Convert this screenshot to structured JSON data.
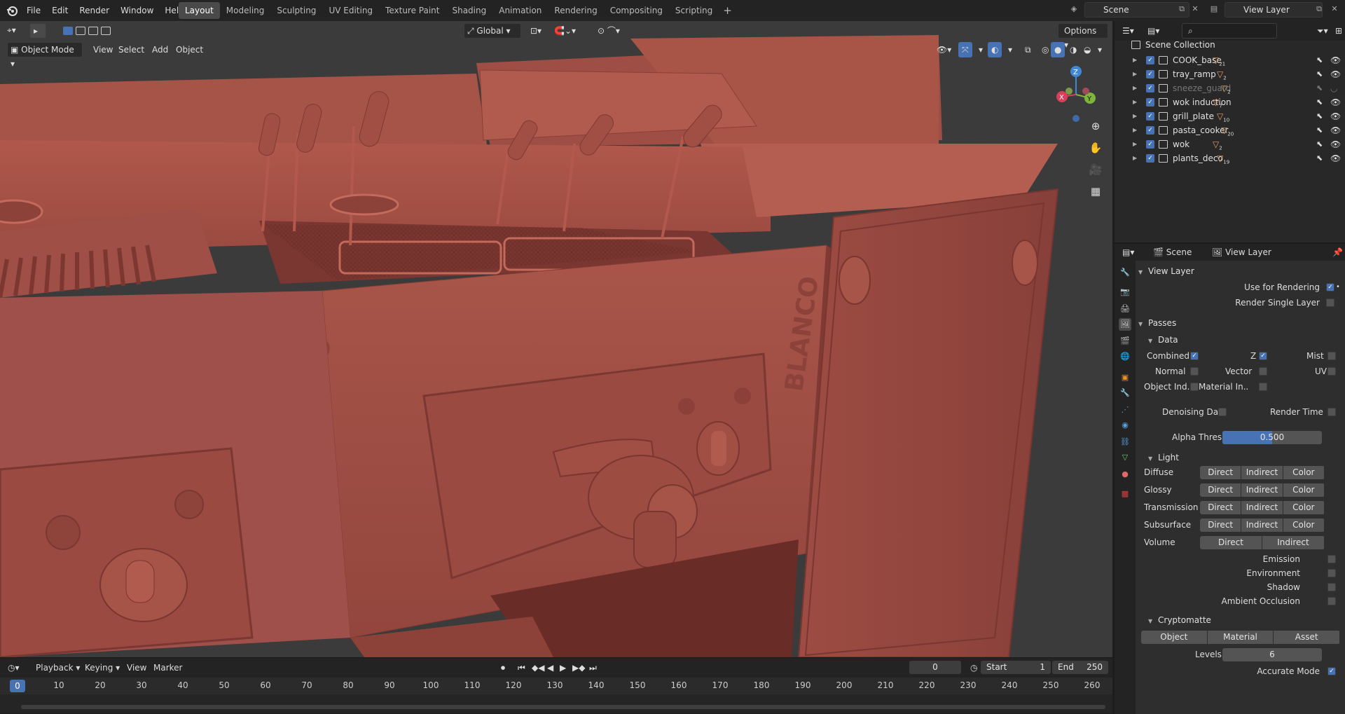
{
  "menu": {
    "items": [
      "File",
      "Edit",
      "Render",
      "Window",
      "Help"
    ]
  },
  "workspaces": {
    "tabs": [
      "Layout",
      "Modeling",
      "Sculpting",
      "UV Editing",
      "Texture Paint",
      "Shading",
      "Animation",
      "Rendering",
      "Compositing",
      "Scripting"
    ],
    "active": "Layout",
    "add": "+"
  },
  "scene": {
    "name": "Scene",
    "view_layer": "View Layer"
  },
  "viewport": {
    "mode": "Object Mode",
    "menus": [
      "View",
      "Select",
      "Add",
      "Object"
    ],
    "orientation": "Global",
    "options": "Options",
    "gizmo": {
      "z": "Z",
      "y": "Y",
      "x": "X"
    },
    "model_text": "BLANCO"
  },
  "timeline": {
    "menus": [
      "Playback",
      "Keying",
      "View",
      "Marker"
    ],
    "current_frame": "0",
    "start_label": "Start",
    "start": "1",
    "end_label": "End",
    "end": "250",
    "ruler": [
      "0",
      "10",
      "20",
      "30",
      "40",
      "50",
      "60",
      "70",
      "80",
      "90",
      "100",
      "110",
      "120",
      "130",
      "140",
      "150",
      "160",
      "170",
      "180",
      "190",
      "200",
      "210",
      "220",
      "230",
      "240",
      "250",
      "260"
    ]
  },
  "outliner": {
    "root": "Scene Collection",
    "items": [
      {
        "name": "COOK_base",
        "count": "21",
        "visible": true
      },
      {
        "name": "tray_ramp",
        "count": "2",
        "visible": true
      },
      {
        "name": "sneeze_guard",
        "count": "2",
        "visible": false
      },
      {
        "name": "wok induction",
        "count": "7",
        "visible": true
      },
      {
        "name": "grill_plate",
        "count": "10",
        "visible": true
      },
      {
        "name": "pasta_cooker",
        "count": "20",
        "visible": true
      },
      {
        "name": "wok",
        "count": "2",
        "visible": true
      },
      {
        "name": "plants_deco",
        "count": "19",
        "visible": true
      }
    ]
  },
  "properties": {
    "header": {
      "scene": "Scene",
      "view_layer": "View Layer"
    },
    "view_layer_section": "View Layer",
    "use_for_rendering": "Use for Rendering",
    "render_single_layer": "Render Single Layer",
    "passes": "Passes",
    "data": "Data",
    "data_items": {
      "combined": "Combined",
      "z": "Z",
      "mist": "Mist",
      "normal": "Normal",
      "vector": "Vector",
      "uv": "UV",
      "object_index": "Object Ind..",
      "material_index": "Material In.."
    },
    "denoising_data": "Denoising Data",
    "render_time": "Render Time",
    "alpha_threshold": {
      "label": "Alpha Threshold",
      "value": "0.500",
      "fraction": 0.5
    },
    "light": "Light",
    "light_rows": [
      {
        "label": "Diffuse",
        "buttons": [
          "Direct",
          "Indirect",
          "Color"
        ]
      },
      {
        "label": "Glossy",
        "buttons": [
          "Direct",
          "Indirect",
          "Color"
        ]
      },
      {
        "label": "Transmission",
        "buttons": [
          "Direct",
          "Indirect",
          "Color"
        ]
      },
      {
        "label": "Subsurface",
        "buttons": [
          "Direct",
          "Indirect",
          "Color"
        ]
      },
      {
        "label": "Volume",
        "buttons": [
          "Direct",
          "Indirect"
        ]
      }
    ],
    "light_checks": [
      "Emission",
      "Environment",
      "Shadow",
      "Ambient Occlusion"
    ],
    "cryptomatte": "Cryptomatte",
    "crypto_buttons": [
      "Object",
      "Material",
      "Asset"
    ],
    "levels": {
      "label": "Levels",
      "value": "6"
    },
    "accurate_mode": "Accurate Mode"
  },
  "colors": {
    "accent": "#4772b3",
    "model": "#a14e44",
    "viewport_bg": "#3b3b3b"
  }
}
